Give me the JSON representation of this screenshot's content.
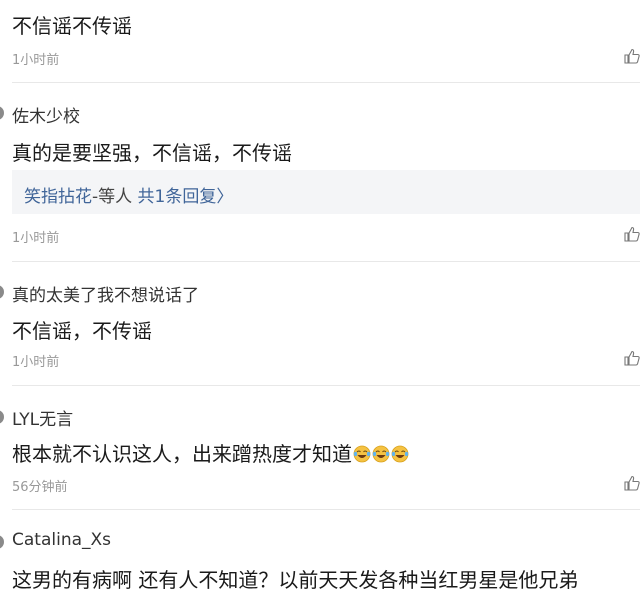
{
  "comments": [
    {
      "user": "",
      "text": "不信谣不传谣",
      "time": "1小时前"
    },
    {
      "user": "佐木少校",
      "text": "真的是要坚强，不信谣，不传谣",
      "time": "1小时前",
      "reply": {
        "names": "笑指拈花",
        "suffix": "-等人",
        "count_label": "共1条回复",
        "arrow": "〉"
      }
    },
    {
      "user": "真的太美了我不想说话了",
      "text": "不信谣，不传谣",
      "time": "1小时前"
    },
    {
      "user": "LYL无言",
      "text": "根本就不认识这人，出来蹭热度才知道",
      "time": "56分钟前"
    },
    {
      "user": "Catalina_Xs",
      "text": "这男的有病啊 还有人不知道？以前天天发各种当红男星是他兄弟",
      "time": ""
    }
  ],
  "icons": {
    "like": "thumbs-up-icon",
    "emoji": "laughing-tears-emoji"
  },
  "colors": {
    "link": "#406599",
    "divider": "#e8e8e8",
    "reply_bg": "#f4f5f7",
    "time": "#999999"
  }
}
